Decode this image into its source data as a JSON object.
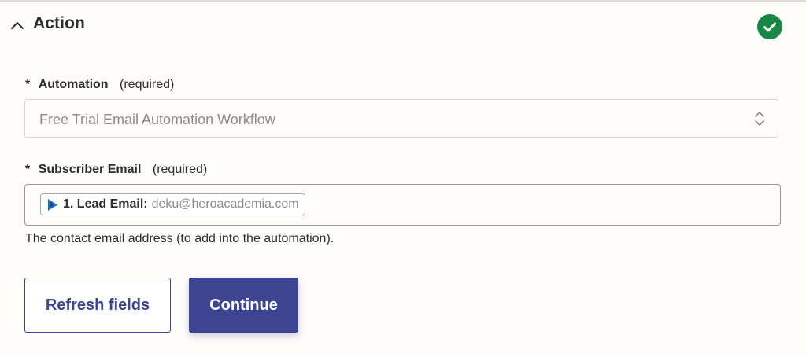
{
  "section": {
    "title": "Action",
    "collapse_icon": "chevron-up-icon",
    "status_icon": "check-circle-icon",
    "status_color": "#188645"
  },
  "fields": {
    "automation": {
      "asterisk": "*",
      "label": "Automation",
      "required_text": "(required)",
      "value": "Free Trial Email Automation Workflow",
      "arrows_icon": "select-arrows-icon"
    },
    "subscriber_email": {
      "asterisk": "*",
      "label": "Subscriber Email",
      "required_text": "(required)",
      "token": {
        "icon": "app-logo-icon",
        "label": "1. Lead Email:",
        "value": "deku@heroacademia.com"
      },
      "help_text": "The contact email address (to add into the automation)."
    }
  },
  "buttons": {
    "refresh": "Refresh fields",
    "continue": "Continue"
  },
  "colors": {
    "primary": "#3d4592",
    "success": "#188645",
    "token_icon": "#1a6fc4"
  }
}
